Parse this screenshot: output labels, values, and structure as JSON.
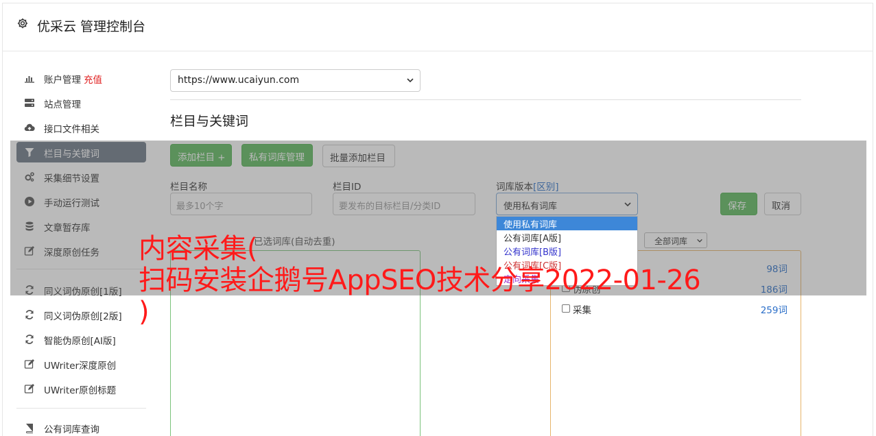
{
  "header": {
    "title": "优采云 管理控制台",
    "icon": "gear-icon"
  },
  "sidebar": {
    "items": [
      {
        "label": "账户管理",
        "extra": "充值",
        "icon": "bar-chart-icon"
      },
      {
        "label": "站点管理",
        "icon": "server-icon"
      },
      {
        "label": "接口文件相关",
        "icon": "cloud-upload-icon"
      },
      {
        "label": "栏目与关键词",
        "icon": "filter-icon",
        "active": true
      },
      {
        "label": "采集细节设置",
        "icon": "cogs-icon"
      },
      {
        "label": "手动运行测试",
        "icon": "play-circle-icon"
      },
      {
        "label": "文章暂存库",
        "icon": "database-icon"
      },
      {
        "label": "深度原创任务",
        "icon": "edit-icon"
      },
      {
        "label": "同义词伪原创[1版]",
        "icon": "refresh-icon"
      },
      {
        "label": "同义词伪原创[2版]",
        "icon": "refresh-icon"
      },
      {
        "label": "智能伪原创[AI版]",
        "icon": "refresh-icon"
      },
      {
        "label": "UWriter深度原创",
        "icon": "edit-icon"
      },
      {
        "label": "UWriter原创标题",
        "icon": "edit-icon"
      },
      {
        "label": "公有词库查询",
        "icon": "book-icon"
      }
    ]
  },
  "site_select": {
    "value": "https://www.ucaiyun.com"
  },
  "section_title": "栏目与关键词",
  "toolbar": {
    "add_column": "添加栏目 +",
    "private_lib": "私有词库管理",
    "batch_add": "批量添加栏目"
  },
  "form": {
    "column_name_label": "栏目名称",
    "column_name_placeholder": "最多10个字",
    "column_id_label": "栏目ID",
    "column_id_placeholder": "要发布的目标栏目/分类ID",
    "lib_version_label": "词库版本",
    "lib_version_link": "[区别]",
    "lib_version_value": "使用私有词库",
    "save": "保存",
    "cancel": "取消"
  },
  "dropdown": {
    "options": [
      {
        "label": "使用私有词库",
        "color": "#ffffff",
        "selected": true
      },
      {
        "label": "公有词库[A版]",
        "color": "#333333"
      },
      {
        "label": "公有词库[B版]",
        "color": "#3333cc"
      },
      {
        "label": "公有词库[C版]",
        "color": "#cc3333"
      },
      {
        "label": "定向采集",
        "color": "#9933cc"
      }
    ]
  },
  "selected_libs_caption": "已选词库(自动去重)",
  "lib_filter": "全部词库",
  "libs": [
    {
      "name": "",
      "count": "98词"
    },
    {
      "name": "伪原创",
      "count": "186词"
    },
    {
      "name": "采集",
      "count": "259词"
    }
  ],
  "watermark": "内容采集(\n扫码安装企鹅号AppSEO技术分享2022-01-26\n)",
  "colors": {
    "accent_green": "#5cb85c",
    "active_nav": "#6c7785",
    "recharge": "#e02020",
    "watermark": "#ff1a1a"
  }
}
